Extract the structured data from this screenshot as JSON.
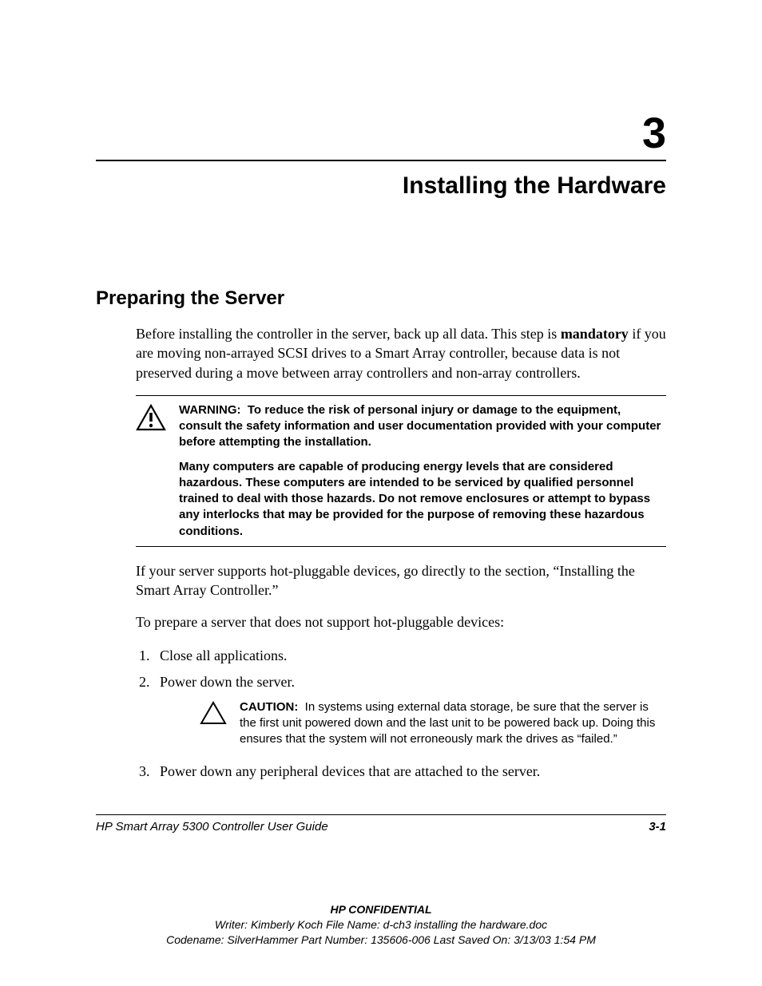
{
  "chapter": {
    "number": "3",
    "title": "Installing the Hardware"
  },
  "section": {
    "title": "Preparing the Server",
    "intro_pre": "Before installing the controller in the server, back up all data. This step is ",
    "intro_bold": "mandatory",
    "intro_post": " if you are moving non-arrayed SCSI drives to a Smart Array controller, because data is not preserved during a move between array controllers and non-array controllers.",
    "warning": {
      "label": "WARNING:",
      "p1": "To reduce the risk of personal injury or damage to the equipment, consult the safety information and user documentation provided with your computer before attempting the installation.",
      "p2": "Many computers are capable of producing energy levels that are considered hazardous. These computers are intended to be serviced by qualified personnel trained to deal with those hazards. Do not remove enclosures or attempt to bypass any interlocks that may be provided for the purpose of removing these hazardous conditions."
    },
    "after_warning": "If your server supports hot-pluggable devices, go directly to the section, “Installing the Smart Array Controller.”",
    "prep_lead": "To prepare a server that does not support hot-pluggable devices:",
    "steps": {
      "s1": "Close all applications.",
      "s2": "Power down the server.",
      "s3": "Power down any peripheral devices that are attached to the server."
    },
    "caution": {
      "label": "CAUTION:",
      "text": "In systems using external data storage, be sure that the server is the first unit powered down and the last unit to be powered back up. Doing this ensures that the system will not erroneously mark the drives as “failed.”"
    }
  },
  "footer": {
    "guide": "HP Smart Array 5300 Controller User Guide",
    "page": "3-1"
  },
  "meta": {
    "confidential": "HP CONFIDENTIAL",
    "line2": "Writer: Kimberly Koch File Name: d-ch3 installing the hardware.doc",
    "line3": "Codename: SilverHammer Part Number: 135606-006 Last Saved On: 3/13/03 1:54 PM"
  }
}
